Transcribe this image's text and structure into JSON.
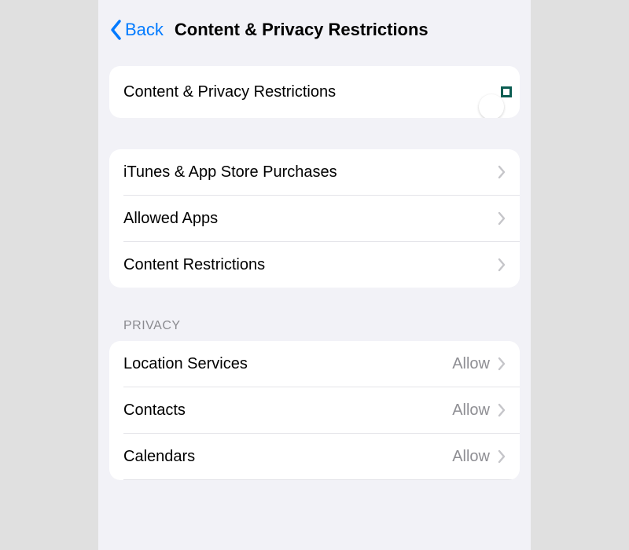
{
  "header": {
    "back_label": "Back",
    "title": "Content & Privacy Restrictions"
  },
  "toggle_group": {
    "label": "Content & Privacy Restrictions",
    "on": true
  },
  "main_group": {
    "items": [
      {
        "label": "iTunes & App Store Purchases"
      },
      {
        "label": "Allowed Apps"
      },
      {
        "label": "Content Restrictions"
      }
    ]
  },
  "privacy_section": {
    "header": "Privacy",
    "items": [
      {
        "label": "Location Services",
        "value": "Allow"
      },
      {
        "label": "Contacts",
        "value": "Allow"
      },
      {
        "label": "Calendars",
        "value": "Allow"
      }
    ]
  },
  "colors": {
    "link": "#007aff",
    "toggle_on": "#34c759",
    "highlight_border": "#0b5d52",
    "bg": "#f2f2f7",
    "secondary_text": "#8e8e93"
  }
}
